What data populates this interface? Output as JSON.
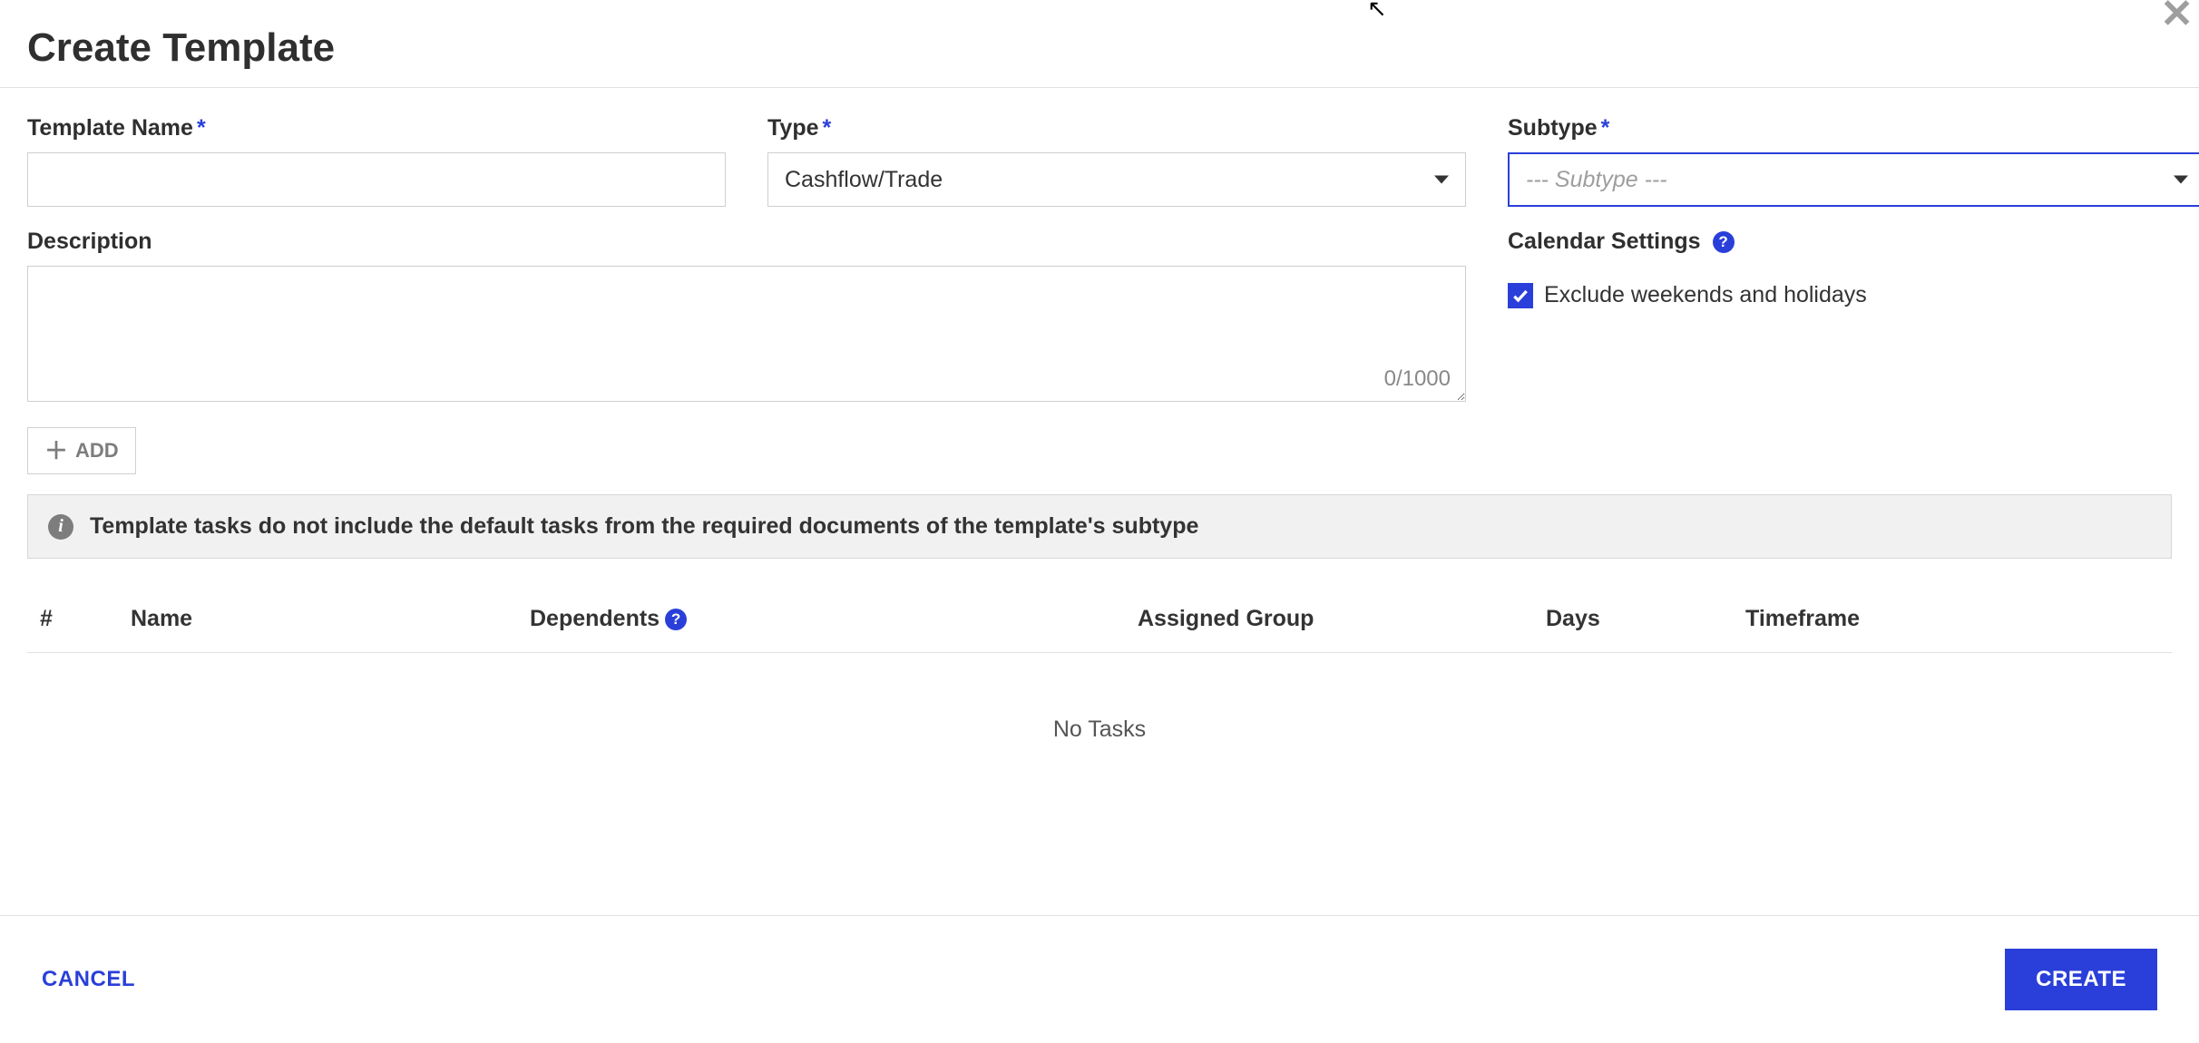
{
  "modal": {
    "title": "Create Template"
  },
  "fields": {
    "template_name": {
      "label": "Template Name",
      "value": ""
    },
    "type": {
      "label": "Type",
      "value": "Cashflow/Trade"
    },
    "subtype": {
      "label": "Subtype",
      "placeholder": "--- Subtype ---"
    },
    "description": {
      "label": "Description",
      "value": "",
      "counter": "0/1000"
    }
  },
  "calendar": {
    "label": "Calendar Settings",
    "exclude_label": "Exclude weekends and holidays",
    "exclude_checked": true
  },
  "add_button": "ADD",
  "info_banner": "Template tasks do not include the default tasks from the required documents of the template's subtype",
  "table": {
    "headers": {
      "idx": "#",
      "name": "Name",
      "dependents": "Dependents",
      "group": "Assigned Group",
      "days": "Days",
      "timeframe": "Timeframe"
    },
    "empty": "No Tasks"
  },
  "footer": {
    "cancel": "CANCEL",
    "create": "CREATE"
  }
}
